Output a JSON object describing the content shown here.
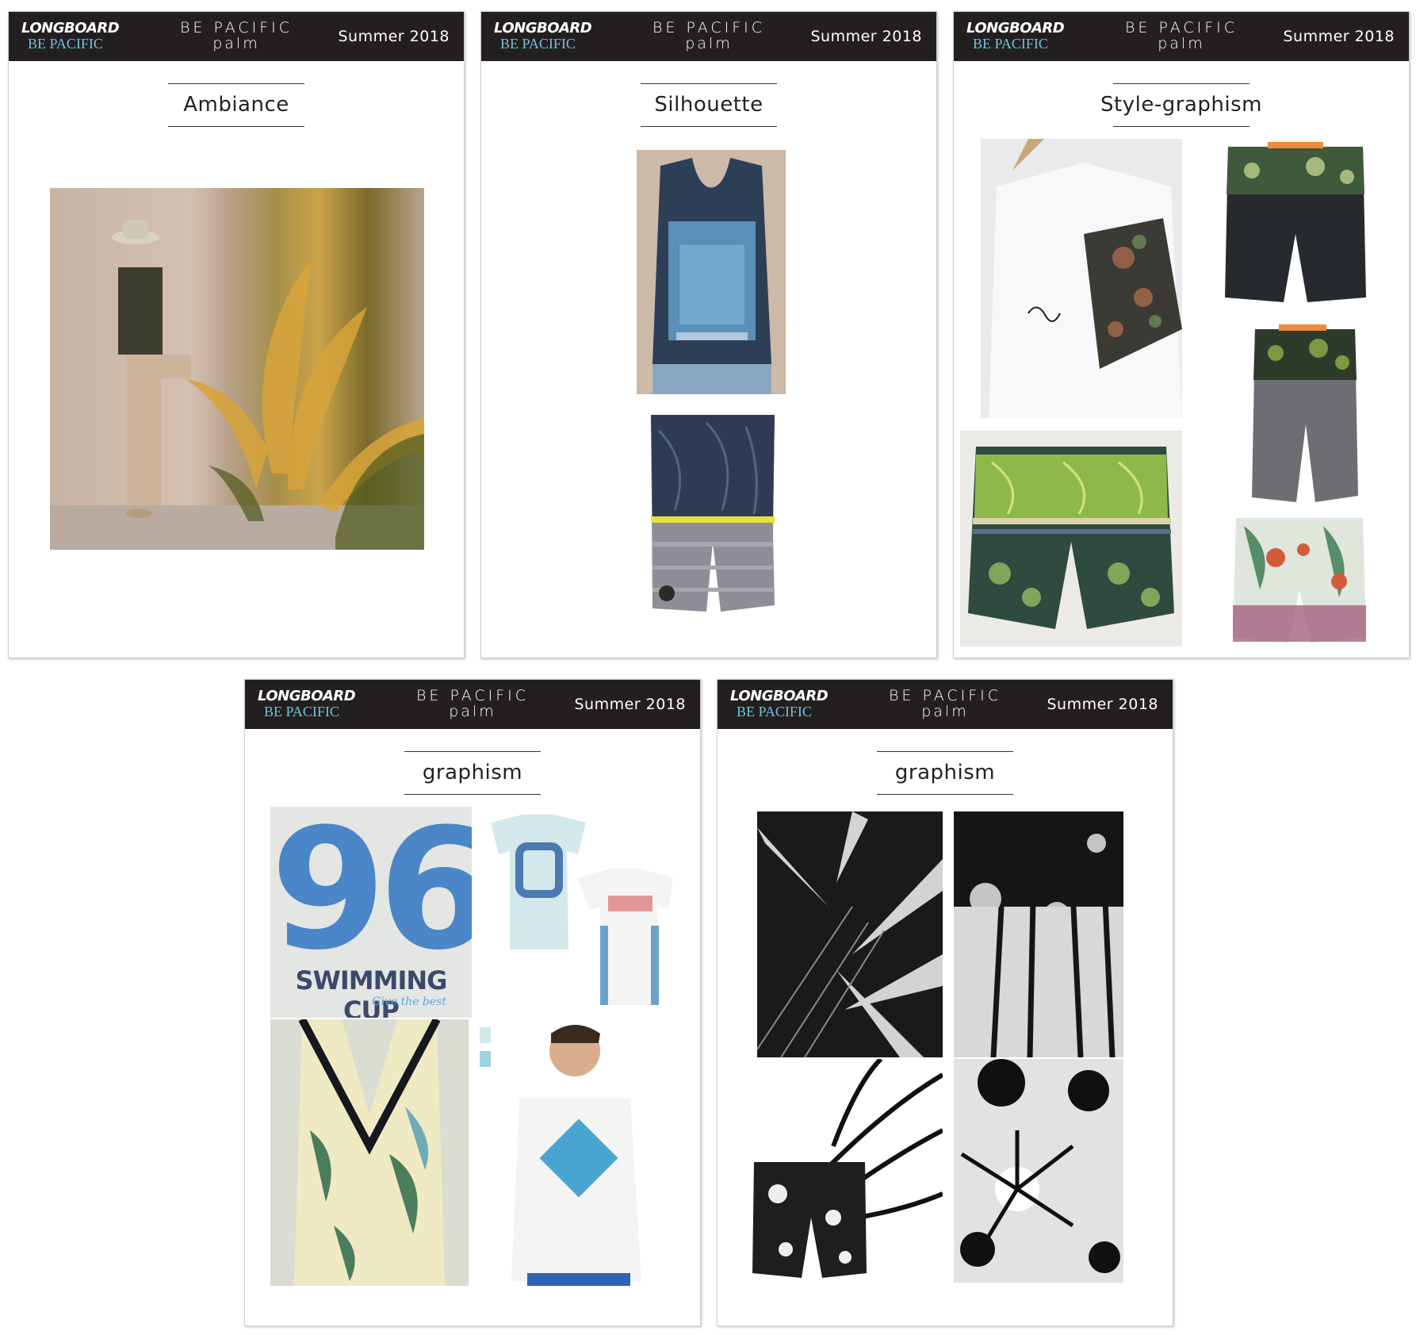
{
  "boards": [
    {
      "brand": "LONGBOARD",
      "brand_sub": "BE PACIFIC",
      "collection_line1": "BE PACIFIC",
      "collection_line2": "palm",
      "season": "Summer 2018",
      "title": "Ambiance",
      "photos": [
        {
          "name": "ambiance-photo-man-with-palms"
        }
      ]
    },
    {
      "brand": "LONGBOARD",
      "brand_sub": "BE PACIFIC",
      "collection_line1": "BE PACIFIC",
      "collection_line2": "palm",
      "season": "Summer 2018",
      "title": "Silhouette",
      "photos": [
        {
          "name": "silhouette-tank-top-photo"
        },
        {
          "name": "silhouette-boardshort-photo"
        }
      ]
    },
    {
      "brand": "LONGBOARD",
      "brand_sub": "BE PACIFIC",
      "collection_line1": "BE PACIFIC",
      "collection_line2": "palm",
      "season": "Summer 2018",
      "title": "Style-graphism",
      "photos": [
        {
          "name": "white-tshirt-floral-sleeve-photo"
        },
        {
          "name": "green-palm-boardshort-photo"
        },
        {
          "name": "dark-floral-yoke-boardshort-photo"
        },
        {
          "name": "grey-palm-boardshort-photo"
        },
        {
          "name": "tropical-floral-boardshort-photo"
        }
      ]
    },
    {
      "brand": "LONGBOARD",
      "brand_sub": "BE PACIFIC",
      "collection_line1": "BE PACIFIC",
      "collection_line2": "palm",
      "season": "Summer 2018",
      "title": "graphism",
      "photos": [
        {
          "name": "swimming-cup-96-print"
        },
        {
          "name": "printed-tees-photo"
        },
        {
          "name": "palm-swimsuit-photo"
        },
        {
          "name": "summer-life-tee-model-photo"
        }
      ],
      "print_text": {
        "number": "96",
        "headline": "SWIMMING CUP",
        "tagline": "Give the best"
      }
    },
    {
      "brand": "LONGBOARD",
      "brand_sub": "BE PACIFIC",
      "collection_line1": "BE PACIFIC",
      "collection_line2": "palm",
      "season": "Summer 2018",
      "title": "graphism",
      "photos": [
        {
          "name": "bw-palm-leaves-closeup"
        },
        {
          "name": "bw-palm-trees-tall"
        },
        {
          "name": "bw-palm-frond-with-boardshort"
        },
        {
          "name": "bw-palm-crowns-sun"
        }
      ]
    }
  ],
  "colors": {
    "header_bg": "#231f20",
    "brand_sub": "#6fc3df",
    "paper": "#ffffff"
  }
}
